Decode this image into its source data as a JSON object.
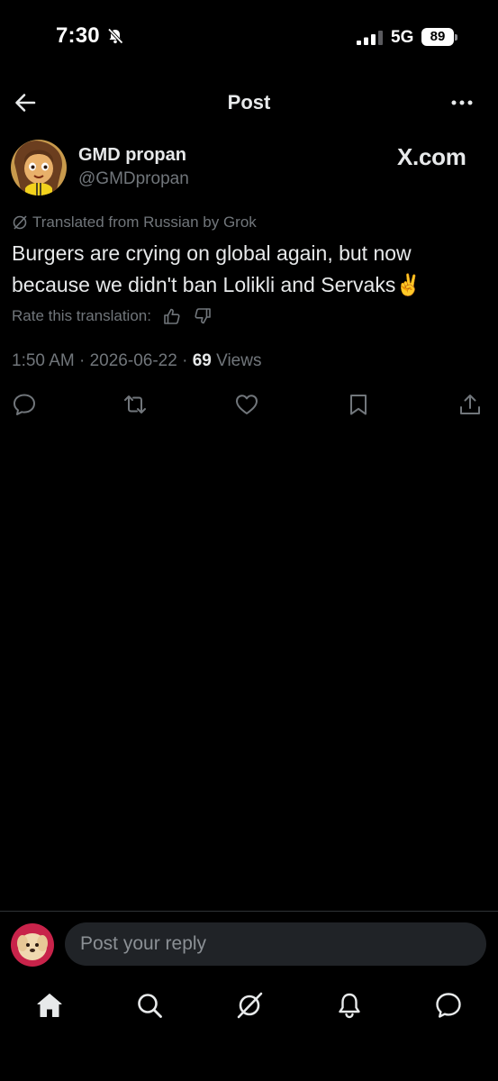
{
  "status_bar": {
    "time": "7:30",
    "network": "5G",
    "battery": "89"
  },
  "header": {
    "title": "Post"
  },
  "post": {
    "author_name": "GMD propan",
    "author_handle": "@GMDpropan",
    "watermark": "X.com",
    "translation_note": "Translated from Russian by Grok",
    "text": "Burgers are crying on global again, but now because we didn't ban Lolikli and Servaks✌️",
    "rate_label": "Rate this translation:",
    "time": "1:50 AM",
    "separator": "·",
    "date": "2026-06-22",
    "views_count": "69",
    "views_label": "Views"
  },
  "reply": {
    "placeholder": "Post your reply"
  },
  "icons": {
    "header": [
      "back-arrow-icon",
      "more-icon"
    ],
    "actions": [
      "reply-icon",
      "repost-icon",
      "like-icon",
      "bookmark-icon",
      "share-icon"
    ],
    "nav": [
      "home-icon",
      "search-icon",
      "grok-icon",
      "notifications-icon",
      "messages-icon"
    ]
  },
  "colors": {
    "background": "#000000",
    "text": "#e7e9ea",
    "muted": "#71767b",
    "input_bg": "#202327"
  }
}
